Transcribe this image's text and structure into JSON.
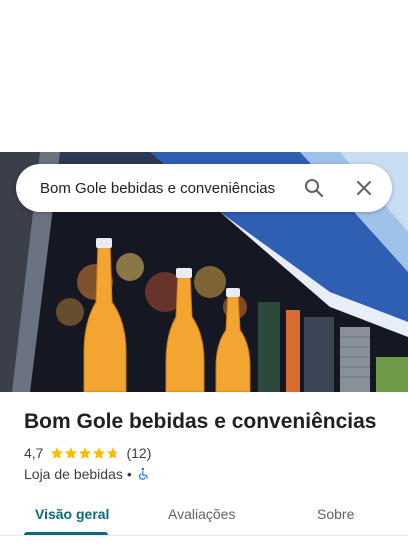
{
  "search": {
    "query": "Bom Gole bebidas e conveniências",
    "search_icon": "search-icon",
    "close_icon": "close-icon"
  },
  "place": {
    "name": "Bom Gole bebidas e conveniências",
    "rating": "4,7",
    "rating_value": 4.7,
    "review_count": "(12)",
    "category": "Loja de bebidas",
    "separator": "•",
    "accessibility_icon": "wheelchair-icon"
  },
  "tabs": [
    {
      "label": "Visão geral",
      "active": true
    },
    {
      "label": "Avaliações",
      "active": false
    },
    {
      "label": "Sobre",
      "active": false
    }
  ],
  "colors": {
    "accent": "#0b6b78",
    "star": "#fbbc04",
    "accessibility": "#1a73e8"
  }
}
